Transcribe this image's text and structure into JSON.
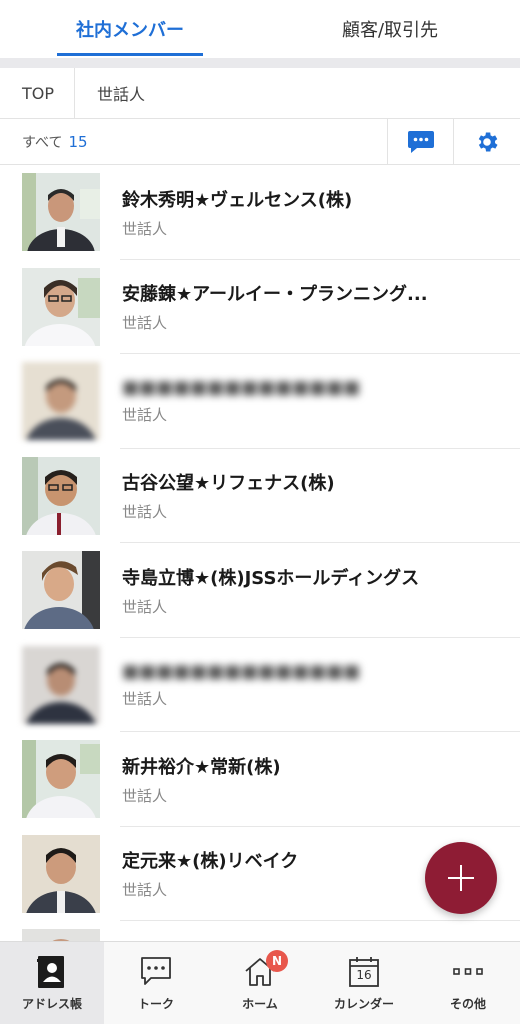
{
  "tabs": [
    {
      "label": "社内メンバー",
      "active": true
    },
    {
      "label": "顧客/取引先",
      "active": false
    }
  ],
  "breadcrumb": [
    "TOP",
    "世話人"
  ],
  "filter": {
    "label": "すべて",
    "count": "15"
  },
  "icons": {
    "message": "chat-bubble-icon",
    "settings": "gear-icon",
    "add": "plus-icon"
  },
  "colors": {
    "accent": "#1f6fd6",
    "fab": "#8e1c34",
    "badge": "#e8574c"
  },
  "contacts": [
    {
      "name": "鈴木秀明★ヴェルセンス(株)",
      "role": "世話人",
      "blurred": false
    },
    {
      "name": "安藤錬★アールイー・プランニング...",
      "role": "世話人",
      "blurred": false
    },
    {
      "name": "",
      "role": "世話人",
      "blurred": true
    },
    {
      "name": "古谷公望★リフェナス(株)",
      "role": "世話人",
      "blurred": false
    },
    {
      "name": "寺島立博★(株)JSSホールディングス",
      "role": "世話人",
      "blurred": false
    },
    {
      "name": "",
      "role": "世話人",
      "blurred": true
    },
    {
      "name": "新井裕介★常新(株)",
      "role": "世話人",
      "blurred": false
    },
    {
      "name": "定元来★(株)リベイク",
      "role": "世話人",
      "blurred": false
    }
  ],
  "nav": [
    {
      "label": "アドレス帳",
      "icon": "address-book-icon",
      "active": true
    },
    {
      "label": "トーク",
      "icon": "talk-icon",
      "active": false
    },
    {
      "label": "ホーム",
      "icon": "home-icon",
      "active": false,
      "badge": "N"
    },
    {
      "label": "カレンダー",
      "icon": "calendar-icon",
      "active": false,
      "calendar_day": "16"
    },
    {
      "label": "その他",
      "icon": "more-icon",
      "active": false
    }
  ]
}
